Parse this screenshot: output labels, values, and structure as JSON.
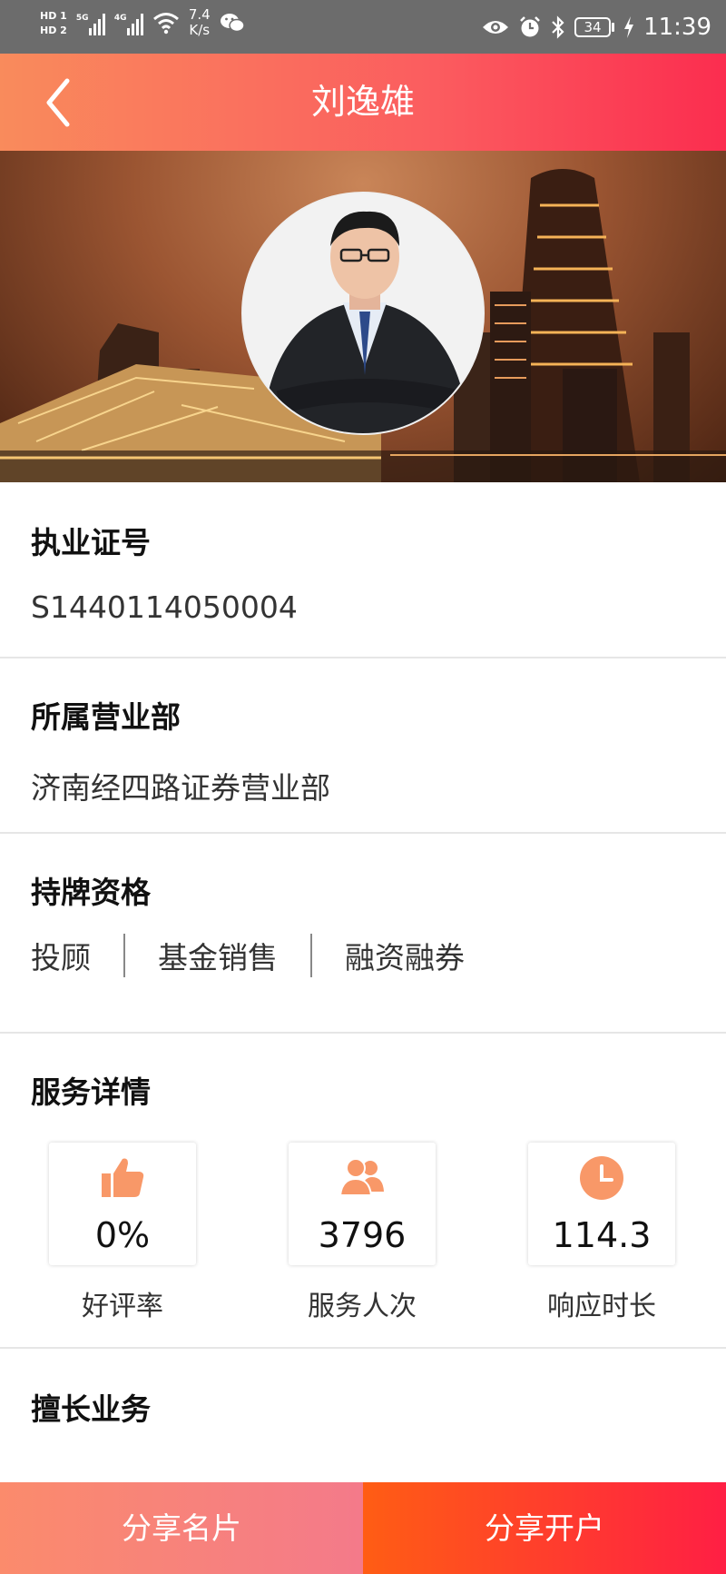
{
  "status_bar": {
    "hd1": "HD 1",
    "hd2": "HD 2",
    "net1": "5G",
    "net2": "4G",
    "speed_value": "7.4",
    "speed_unit": "K/s",
    "battery": "34",
    "time": "11:39"
  },
  "header": {
    "title": "刘逸雄"
  },
  "license": {
    "title": "执业证号",
    "value": "S1440114050004"
  },
  "branch": {
    "title": "所属营业部",
    "value": "济南经四路证券营业部"
  },
  "qualifications": {
    "title": "持牌资格",
    "items": [
      "投顾",
      "基金销售",
      "融资融券"
    ]
  },
  "service": {
    "title": "服务详情",
    "stats": [
      {
        "icon": "thumbs-up-icon",
        "value": "0%",
        "label": "好评率"
      },
      {
        "icon": "users-icon",
        "value": "3796",
        "label": "服务人次"
      },
      {
        "icon": "clock-icon",
        "value": "114.3",
        "label": "响应时长"
      }
    ]
  },
  "specialty": {
    "title": "擅长业务"
  },
  "actions": {
    "share_card": "分享名片",
    "share_open": "分享开户"
  },
  "colors": {
    "accent": "#fb4a5a",
    "icon": "#f89868"
  }
}
